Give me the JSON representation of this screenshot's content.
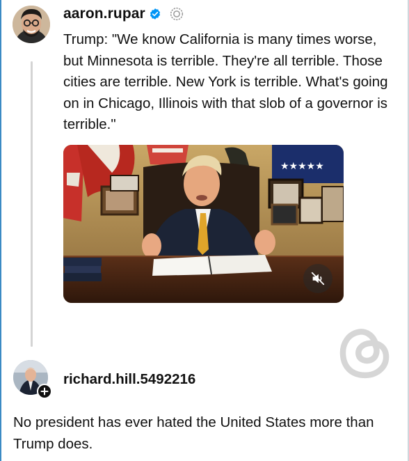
{
  "post": {
    "username": "aaron.rupar",
    "verified": true,
    "text": "Trump: \"We know California is many times worse, but Minnesota is terrible. They're all terrible. Those cities are terrible. New York is terrible. What's going on in Chicago, Illinois with that slob of a governor is terrible.\"",
    "media": {
      "type": "video",
      "muted": true,
      "mute_icon": "speaker-muted-icon"
    }
  },
  "reply": {
    "username": "richard.hill.5492216",
    "follow_icon": "plus-icon",
    "text": "No president has ever hated the United States more than Trump does."
  },
  "icons": {
    "verified": "verified-badge-icon",
    "threads_logo": "threads-logo-icon"
  },
  "colors": {
    "verified_blue": "#0095f6",
    "text": "#101010",
    "thread_line": "#d4d4d4",
    "watermark": "#d6d6d6"
  }
}
